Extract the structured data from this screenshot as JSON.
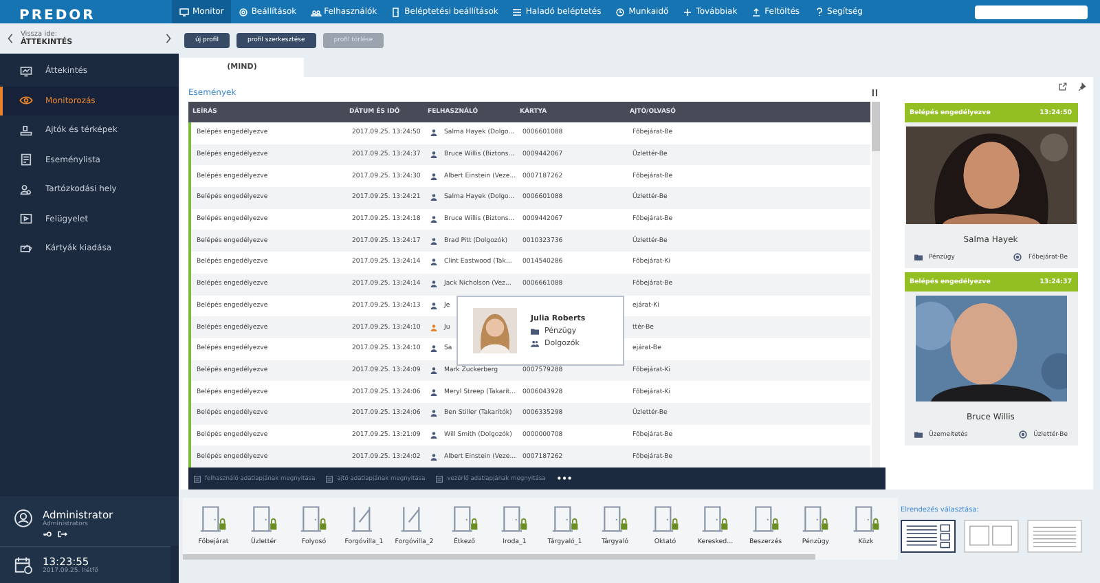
{
  "topbar": {
    "logo": "PREDOR",
    "nav": [
      {
        "label": "Monitor",
        "selected": true
      },
      {
        "label": "Beállítások",
        "selected": false
      },
      {
        "label": "Felhasználók",
        "selected": false
      },
      {
        "label": "Beléptetési beállítások",
        "selected": false
      },
      {
        "label": "Haladó beléptetés",
        "selected": false
      },
      {
        "label": "Munkaidő",
        "selected": false
      },
      {
        "label": "Továbbiak",
        "selected": false
      },
      {
        "label": "Feltöltés",
        "selected": false
      },
      {
        "label": "Segítség",
        "selected": false
      }
    ]
  },
  "sidebar": {
    "back_label": "Vissza ide:",
    "back_target": "ÁTTEKINTÉS",
    "items": [
      {
        "label": "Áttekintés",
        "selected": false
      },
      {
        "label": "Monitorozás",
        "selected": true
      },
      {
        "label": "Ajtók és térképek",
        "selected": false
      },
      {
        "label": "Eseménylista",
        "selected": false
      },
      {
        "label": "Tartózkodási hely",
        "selected": false
      },
      {
        "label": "Felügyelet",
        "selected": false
      },
      {
        "label": "Kártyák kiadása",
        "selected": false
      }
    ],
    "user": {
      "name": "Administrator",
      "role": "Administrators"
    },
    "clock": {
      "time": "13:23:55",
      "date": "2017.09.25. hétfő"
    }
  },
  "toolbar": [
    {
      "label": "új profil",
      "disabled": false
    },
    {
      "label": "profil szerkesztése",
      "disabled": false
    },
    {
      "label": "profil törlése",
      "disabled": true
    }
  ],
  "tabs": [
    {
      "label": "(MIND)",
      "selected": true
    }
  ],
  "events": {
    "title": "Események",
    "columns": [
      "LEÍRÁS",
      "DÁTUM ÉS IDŐ",
      "FELHASZNÁLÓ",
      "KÁRTYA",
      "AJTÓ/OLVASÓ"
    ],
    "rows": [
      {
        "description": "Belépés engedélyezve",
        "datetime": "2017.09.25. 13:24:50",
        "user": "Salma Hayek (Dolgo...",
        "card": "0006601088",
        "door": "Főbejárat-Be",
        "color": "#4a5a78"
      },
      {
        "description": "Belépés engedélyezve",
        "datetime": "2017.09.25. 13:24:37",
        "user": "Bruce Willis (Biztons...",
        "card": "0009442067",
        "door": "Üzlettér-Be",
        "color": "#4a5a78"
      },
      {
        "description": "Belépés engedélyezve",
        "datetime": "2017.09.25. 13:24:30",
        "user": "Albert Einstein (Veze...",
        "card": "0007187262",
        "door": "Főbejárat-Be",
        "color": "#4a5a78"
      },
      {
        "description": "Belépés engedélyezve",
        "datetime": "2017.09.25. 13:24:21",
        "user": "Salma Hayek (Dolgo...",
        "card": "0006601088",
        "door": "Üzlettér-Be",
        "color": "#4a5a78"
      },
      {
        "description": "Belépés engedélyezve",
        "datetime": "2017.09.25. 13:24:18",
        "user": "Bruce Willis (Biztons...",
        "card": "0009442067",
        "door": "Főbejárat-Be",
        "color": "#4a5a78"
      },
      {
        "description": "Belépés engedélyezve",
        "datetime": "2017.09.25. 13:24:17",
        "user": "Brad Pitt (Dolgozók)",
        "card": "0010323736",
        "door": "Üzlettér-Be",
        "color": "#4a5a78"
      },
      {
        "description": "Belépés engedélyezve",
        "datetime": "2017.09.25. 13:24:14",
        "user": "Clint Eastwood (Tak...",
        "card": "0014540286",
        "door": "Főbejárat-Ki",
        "color": "#4a5a78"
      },
      {
        "description": "Belépés engedélyezve",
        "datetime": "2017.09.25. 13:24:14",
        "user": "Jack Nicholson (Vez...",
        "card": "0006661088",
        "door": "Főbejárat-Be",
        "color": "#4a5a78"
      },
      {
        "description": "Belépés engedélyezve",
        "datetime": "2017.09.25. 13:24:13",
        "user": "Je",
        "door": "ejárat-Ki",
        "color": "#4a5a78"
      },
      {
        "description": "Belépés engedélyezve",
        "datetime": "2017.09.25. 13:24:10",
        "user": "Ju",
        "door": "ttér-Be",
        "color": "#e8822a"
      },
      {
        "description": "Belépés engedélyezve",
        "datetime": "2017.09.25. 13:24:10",
        "user": "Sa",
        "door": "ejárat-Be",
        "color": "#4a5a78"
      },
      {
        "description": "Belépés engedélyezve",
        "datetime": "2017.09.25. 13:24:09",
        "user": "Mark Zuckerberg",
        "card": "0007579288",
        "door": "Főbejárat-Ki",
        "color": "#4a5a78"
      },
      {
        "description": "Belépés engedélyezve",
        "datetime": "2017.09.25. 13:24:06",
        "user": "Meryl Streep (Takarít...",
        "card": "0006043928",
        "door": "Főbejárat-Ki",
        "color": "#4a5a78"
      },
      {
        "description": "Belépés engedélyezve",
        "datetime": "2017.09.25. 13:24:06",
        "user": "Ben Stiller (Takarítók)",
        "card": "0006335298",
        "door": "Üzlettér-Be",
        "color": "#4a5a78"
      },
      {
        "description": "Belépés engedélyezve",
        "datetime": "2017.09.25. 13:21:09",
        "user": "Will Smith (Dolgozók)",
        "card": "0000000708",
        "door": "Főbejárat-Be",
        "color": "#4a5a78"
      },
      {
        "description": "Belépés engedélyezve",
        "datetime": "2017.09.25. 13:24:02",
        "user": "Albert Einstein (Veze...",
        "card": "0007187262",
        "door": "Főbejárat-Be",
        "color": "#4a5a78"
      }
    ],
    "actions": [
      "felhasználó adatlapjának megnyitása",
      "ajtó adatlapjának megnyitása",
      "vezérlő adatlapjának megnyitása",
      "•••"
    ]
  },
  "popup": {
    "name": "Julia Roberts",
    "department": "Pénzügy",
    "group": "Dolgozók"
  },
  "cards": [
    {
      "status": "Belépés engedélyezve",
      "time": "13:24:50",
      "name": "Salma Hayek",
      "department": "Pénzügy",
      "door": "Főbejárat-Be"
    },
    {
      "status": "Belépés engedélyezve",
      "time": "13:24:37",
      "name": "Bruce Willis",
      "department": "Üzemeltetés",
      "door": "Üzlettér-Be"
    }
  ],
  "doors": [
    {
      "label": "Főbejárat",
      "kind": "door"
    },
    {
      "label": "Üzlettér",
      "kind": "door"
    },
    {
      "label": "Folyosó",
      "kind": "door"
    },
    {
      "label": "Forgóvilla_1",
      "kind": "turnstile"
    },
    {
      "label": "Forgóvilla_2",
      "kind": "turnstile"
    },
    {
      "label": "Étkező",
      "kind": "door"
    },
    {
      "label": "Iroda_1",
      "kind": "door"
    },
    {
      "label": "Tárgyaló_1",
      "kind": "door"
    },
    {
      "label": "Tárgyaló",
      "kind": "door"
    },
    {
      "label": "Oktató",
      "kind": "door"
    },
    {
      "label": "Keresked...",
      "kind": "door"
    },
    {
      "label": "Beszerzés",
      "kind": "door"
    },
    {
      "label": "Pénzügy",
      "kind": "door"
    },
    {
      "label": "Közk",
      "kind": "door"
    }
  ],
  "layout_picker": {
    "label": "Elrendezés választása:",
    "options": [
      {
        "kind": "list-cards",
        "selected": true
      },
      {
        "kind": "two-columns",
        "selected": false
      },
      {
        "kind": "lines",
        "selected": false
      }
    ]
  }
}
